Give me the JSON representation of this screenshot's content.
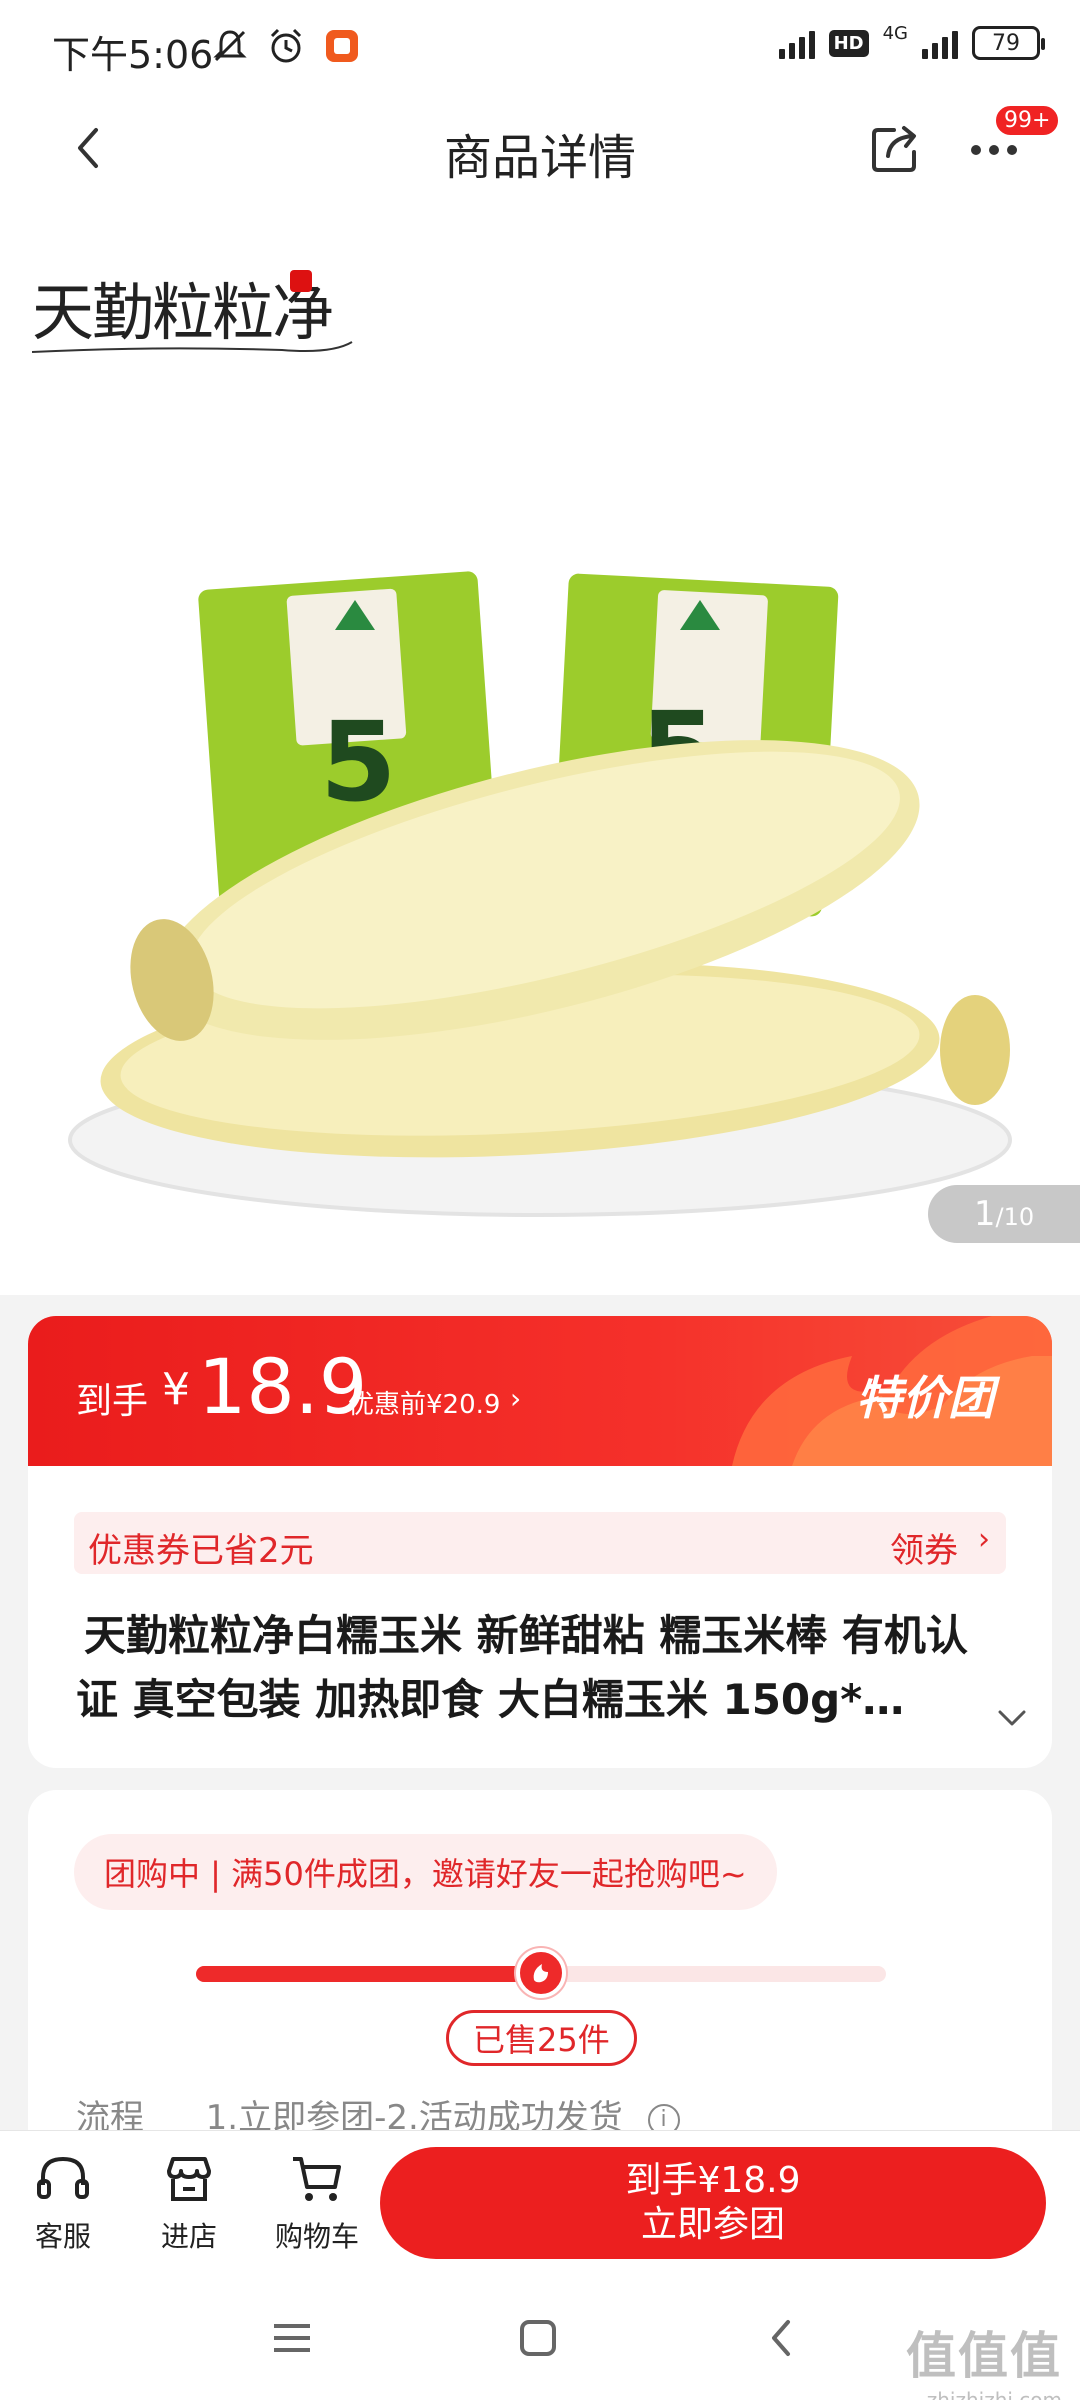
{
  "status_bar": {
    "time": "下午5:06",
    "network": "4G",
    "hd": "HD",
    "battery": "79"
  },
  "header": {
    "title": "商品详情",
    "more_badge": "99+"
  },
  "gallery": {
    "brand_logo": "天勤粒粒净",
    "counter_current": "1",
    "counter_total": "/10"
  },
  "price": {
    "label": "到手",
    "currency": "¥",
    "value": "18.9",
    "original": "优惠前¥20.9",
    "arrow": "›",
    "promo_badge": "特价团"
  },
  "coupon": {
    "text": "优惠券已省2元",
    "action": "领券",
    "arrow": "›"
  },
  "product": {
    "title": "天勤粒粒净白糯玉米 新鲜甜粘 糯玉米棒 有机认证 真空包装 加热即食 大白糯玉米 150g*…"
  },
  "group": {
    "status_text": "团购中 | 满50件成团，邀请好友一起抢购吧~",
    "sold_label": "已售25件",
    "sold": 25,
    "target": 50,
    "flow_label": "流程",
    "flow_steps": "1.立即参团-2.活动成功发货",
    "info_glyph": "i"
  },
  "bottom_bar": {
    "service_label": "客服",
    "store_label": "进店",
    "cart_label": "购物车",
    "join_price": "到手¥18.9",
    "join_label": "立即参团"
  },
  "watermark": {
    "main": "值值值",
    "sub": "zhizhizhi.com"
  },
  "colors": {
    "accent": "#ec1f1f",
    "coupon_bg": "#fdeeee",
    "text_dark": "#1a1a1a",
    "muted": "#888888"
  },
  "icons": {
    "back": "chevron-left-icon",
    "share": "share-icon",
    "more": "more-dots-icon",
    "service": "headset-icon",
    "store": "store-icon",
    "cart": "cart-icon"
  }
}
